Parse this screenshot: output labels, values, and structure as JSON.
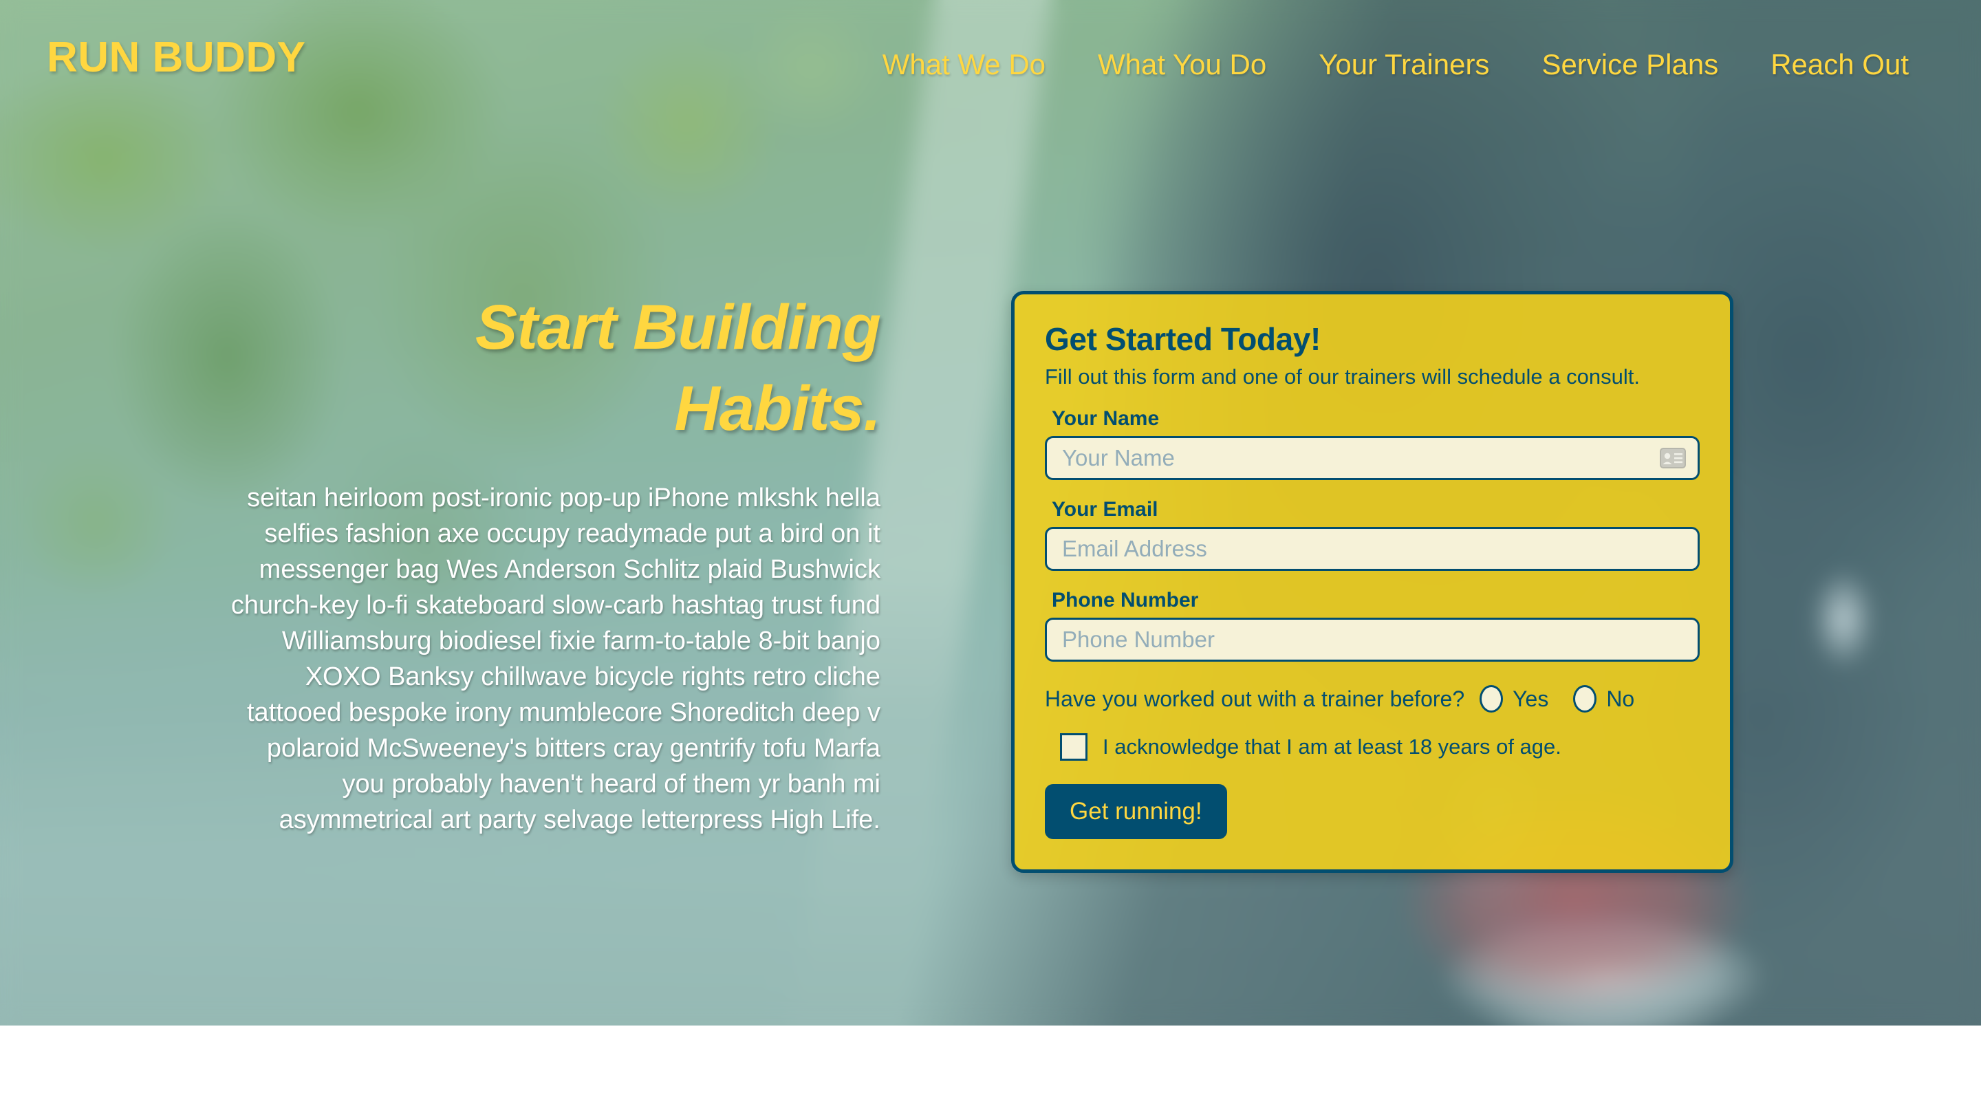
{
  "header": {
    "brand": "RUN BUDDY",
    "nav": [
      {
        "label": "What We Do"
      },
      {
        "label": "What You Do"
      },
      {
        "label": "Your Trainers"
      },
      {
        "label": "Service Plans"
      },
      {
        "label": "Reach Out"
      }
    ]
  },
  "hero": {
    "headline_line1": "Start Building",
    "headline_line2": "Habits.",
    "lead": "seitan heirloom post-ironic pop-up iPhone mlkshk hella selfies fashion axe occupy readymade put a bird on it messenger bag Wes Anderson Schlitz plaid Bushwick church-key lo-fi skateboard slow-carb hashtag trust fund Williamsburg biodiesel fixie farm-to-table 8-bit banjo XOXO Banksy chillwave bicycle rights retro cliche tattooed bespoke irony mumblecore Shoreditch deep v polaroid McSweeney's bitters cray gentrify tofu Marfa you probably haven't heard of them yr banh mi asymmetrical art party selvage letterpress High Life."
  },
  "form": {
    "title": "Get Started Today!",
    "subtitle": "Fill out this form and one of our trainers will schedule a consult.",
    "name": {
      "label": "Your Name",
      "placeholder": "Your Name",
      "value": "",
      "icon": "contact-card-icon"
    },
    "email": {
      "label": "Your Email",
      "placeholder": "Email Address",
      "value": ""
    },
    "phone": {
      "label": "Phone Number",
      "placeholder": "Phone Number",
      "value": ""
    },
    "trainer_question": "Have you worked out with a trainer before?",
    "trainer_yes": "Yes",
    "trainer_no": "No",
    "acknowledge": "I acknowledge that I am at least 18 years of age.",
    "submit": "Get running!"
  },
  "colors": {
    "brand_yellow": "#ffd740",
    "card_yellow": "#f0ce1d",
    "navy": "#024e70",
    "input_cream": "#f6f2d8",
    "placeholder_gray": "#93adb9"
  }
}
